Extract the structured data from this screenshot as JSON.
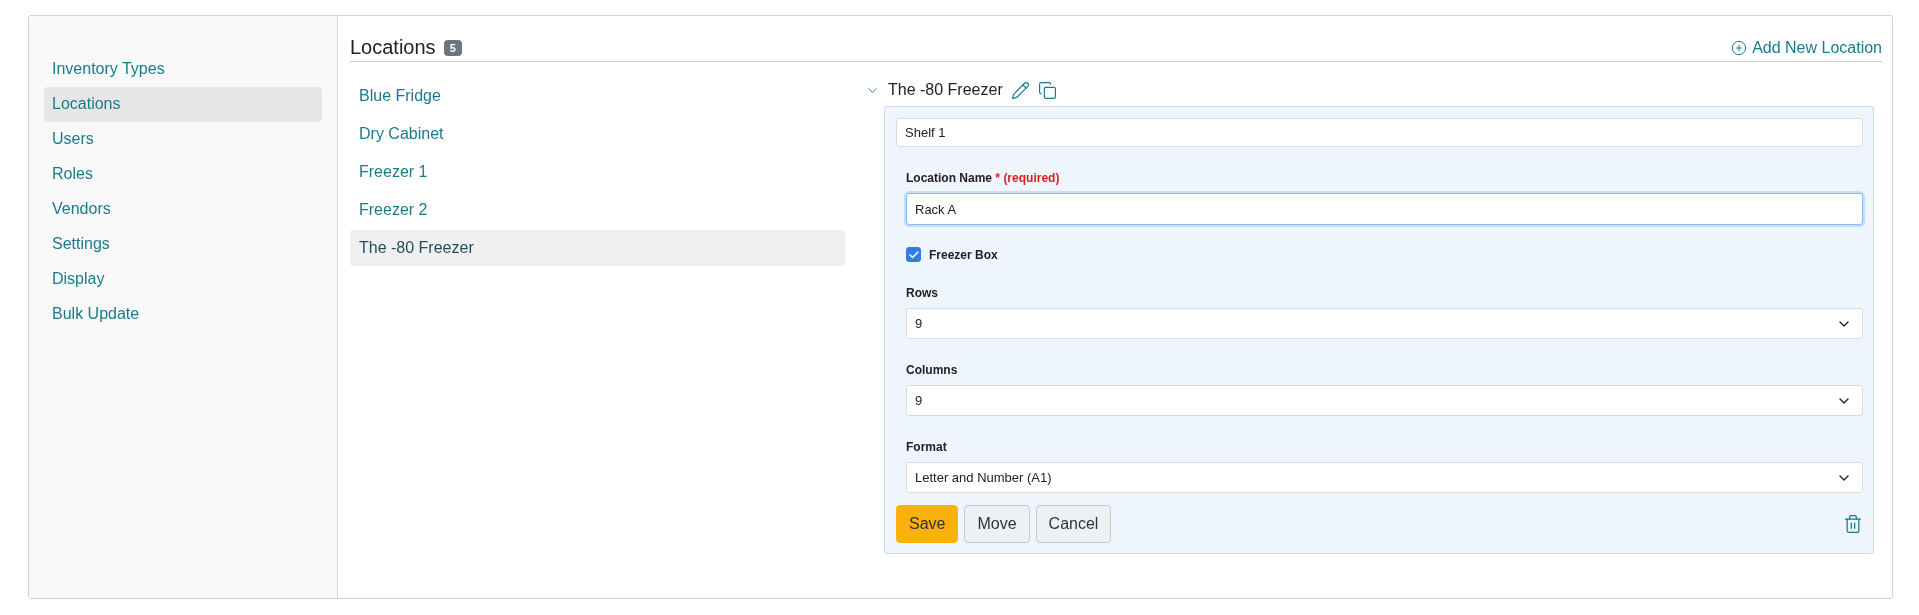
{
  "sidebar": {
    "items": [
      {
        "label": "Inventory Types",
        "selected": false
      },
      {
        "label": "Locations",
        "selected": true
      },
      {
        "label": "Users",
        "selected": false
      },
      {
        "label": "Roles",
        "selected": false
      },
      {
        "label": "Vendors",
        "selected": false
      },
      {
        "label": "Settings",
        "selected": false
      },
      {
        "label": "Display",
        "selected": false
      },
      {
        "label": "Bulk Update",
        "selected": false
      }
    ]
  },
  "header": {
    "title": "Locations",
    "count": "5",
    "add_link": "Add New Location"
  },
  "locations": [
    {
      "label": "Blue Fridge",
      "selected": false
    },
    {
      "label": "Dry Cabinet",
      "selected": false
    },
    {
      "label": "Freezer 1",
      "selected": false
    },
    {
      "label": "Freezer 2",
      "selected": false
    },
    {
      "label": "The -80 Freezer",
      "selected": true
    }
  ],
  "detail": {
    "title": "The -80 Freezer",
    "expanded": true,
    "path_value": "Shelf 1",
    "name_label": "Location Name",
    "required_mark": "*",
    "required_text": "(required)",
    "name_value": "Rack A",
    "freezer_box": {
      "label": "Freezer Box",
      "checked": true
    },
    "selects": [
      {
        "label": "Rows",
        "value": "9"
      },
      {
        "label": "Columns",
        "value": "9"
      },
      {
        "label": "Format",
        "value": "Letter and Number (A1)"
      }
    ],
    "buttons": [
      {
        "label": "Save",
        "kind": "primary"
      },
      {
        "label": "Move",
        "kind": "secondary"
      },
      {
        "label": "Cancel",
        "kind": "secondary"
      }
    ]
  }
}
